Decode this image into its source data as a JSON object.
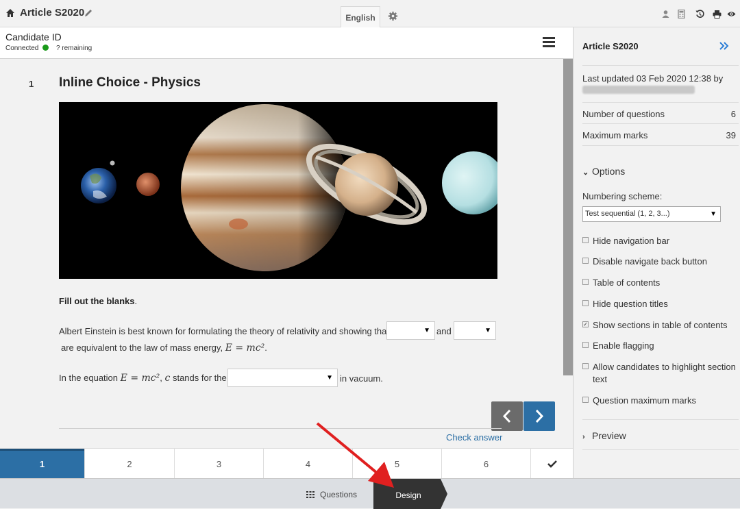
{
  "topbar": {
    "title": "Article S2020",
    "language_tab": "English",
    "icons": [
      "home-icon",
      "pencil-icon",
      "settings-icon",
      "user-icon",
      "calculator-icon",
      "history-icon",
      "print-icon",
      "eye-icon"
    ]
  },
  "candidate": {
    "title": "Candidate ID",
    "status": "Connected",
    "remaining": "? remaining",
    "status_color": "#1a9a1a"
  },
  "question": {
    "number": "1",
    "title": "Inline Choice - Physics",
    "instruction_bold": "Fill out the blanks",
    "instruction_end": ".",
    "sentence1_a": "Albert Einstein is best known for formulating the theory of relativity and showing that",
    "sentence1_and": "and",
    "sentence1_b": "are equivalent to the law of mass energy,",
    "formula": "E = mc²",
    "sentence1_end": ".",
    "sentence2_a": "In the equation",
    "sentence2_var": "c",
    "sentence2_b": "stands for the",
    "sentence2_c": "in vacuum.",
    "check_answer": "Check answer"
  },
  "tabs": [
    "1",
    "2",
    "3",
    "4",
    "5",
    "6"
  ],
  "tabs_active": "1",
  "footer": {
    "questions_label": "Questions",
    "design_label": "Design"
  },
  "panel": {
    "title": "Article S2020",
    "last_updated": "Last updated 03 Feb 2020 12:38 by",
    "num_questions_label": "Number of questions",
    "num_questions_value": "6",
    "max_marks_label": "Maximum marks",
    "max_marks_value": "39",
    "options_label": "Options",
    "numbering_label": "Numbering scheme:",
    "numbering_value": "Test sequential (1, 2, 3...)",
    "options": [
      {
        "label": "Hide navigation bar",
        "checked": false
      },
      {
        "label": "Disable navigate back button",
        "checked": false
      },
      {
        "label": "Table of contents",
        "checked": false
      },
      {
        "label": "Hide question titles",
        "checked": false
      },
      {
        "label": "Show sections in table of contents",
        "checked": true
      },
      {
        "label": "Enable flagging",
        "checked": false
      },
      {
        "label": "Allow candidates to highlight section text",
        "checked": false
      },
      {
        "label": "Question maximum marks",
        "checked": false
      }
    ],
    "preview_label": "Preview"
  },
  "colors": {
    "accent": "#2c6fa5",
    "nav_prev": "#6b6b6b",
    "design_tab": "#333333",
    "arrow": "#e02020"
  }
}
